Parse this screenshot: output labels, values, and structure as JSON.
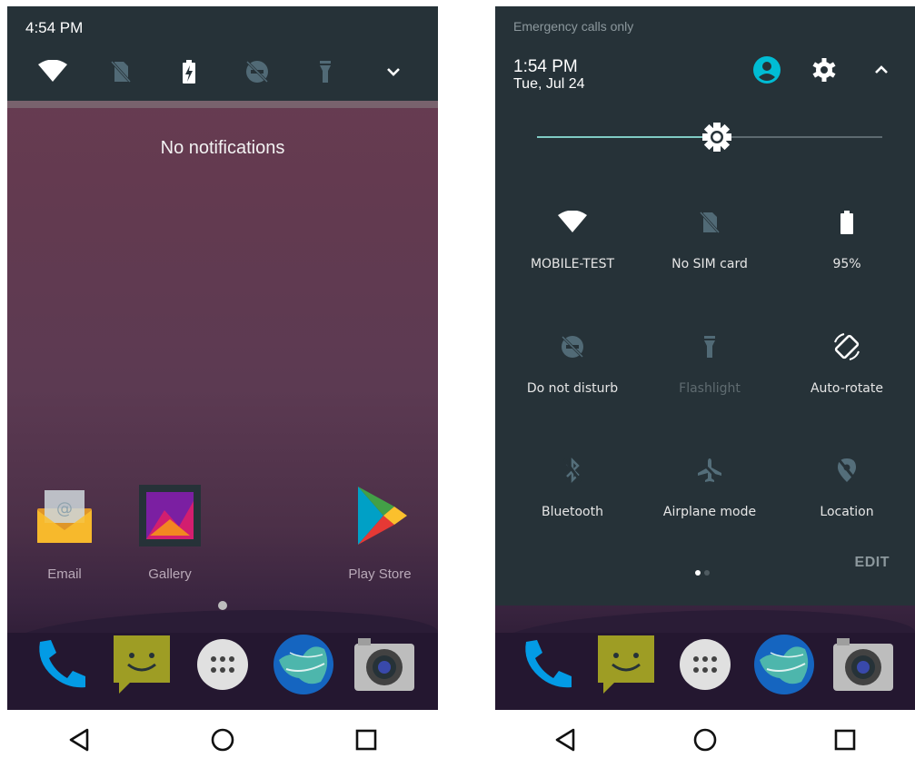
{
  "left_screen": {
    "status_time": "4:54 PM",
    "quick_settings_icons": [
      "wifi-icon",
      "no-sim-icon",
      "battery-charging-icon",
      "do-not-disturb-icon",
      "flashlight-icon",
      "chevron-down-icon"
    ],
    "notification_message": "No notifications",
    "home_apps": [
      {
        "icon": "email-icon",
        "label": "Email"
      },
      {
        "icon": "gallery-icon",
        "label": "Gallery"
      },
      {
        "icon": "play-store-icon",
        "label": "Play Store"
      }
    ],
    "dock_apps": [
      "phone-icon",
      "messaging-icon",
      "app-drawer-icon",
      "browser-icon",
      "camera-icon"
    ],
    "nav_buttons": [
      "back-icon",
      "home-icon",
      "recents-icon"
    ]
  },
  "right_screen": {
    "carrier_text": "Emergency calls only",
    "time": "1:54 PM",
    "date": "Tue, Jul 24",
    "header_icons": [
      "user-account-icon",
      "settings-icon",
      "chevron-up-icon"
    ],
    "brightness_level": 0.52,
    "tiles": [
      {
        "icon": "wifi-icon",
        "label": "MOBILE-TEST",
        "active": true
      },
      {
        "icon": "no-sim-icon",
        "label": "No SIM card",
        "active": false
      },
      {
        "icon": "battery-icon",
        "label": "95%",
        "active": true
      },
      {
        "icon": "do-not-disturb-icon",
        "label": "Do not disturb",
        "active": false
      },
      {
        "icon": "flashlight-icon",
        "label": "Flashlight",
        "active": false
      },
      {
        "icon": "auto-rotate-icon",
        "label": "Auto-rotate",
        "active": true
      },
      {
        "icon": "bluetooth-off-icon",
        "label": "Bluetooth",
        "active": false
      },
      {
        "icon": "airplane-icon",
        "label": "Airplane mode",
        "active": false
      },
      {
        "icon": "location-off-icon",
        "label": "Location",
        "active": false
      }
    ],
    "edit_label": "EDIT",
    "page_indicator": {
      "pages": 2,
      "current": 1
    }
  },
  "colors": {
    "shade": "#263238",
    "accent": "#00bcd4",
    "brightness": "#80cbc4"
  }
}
